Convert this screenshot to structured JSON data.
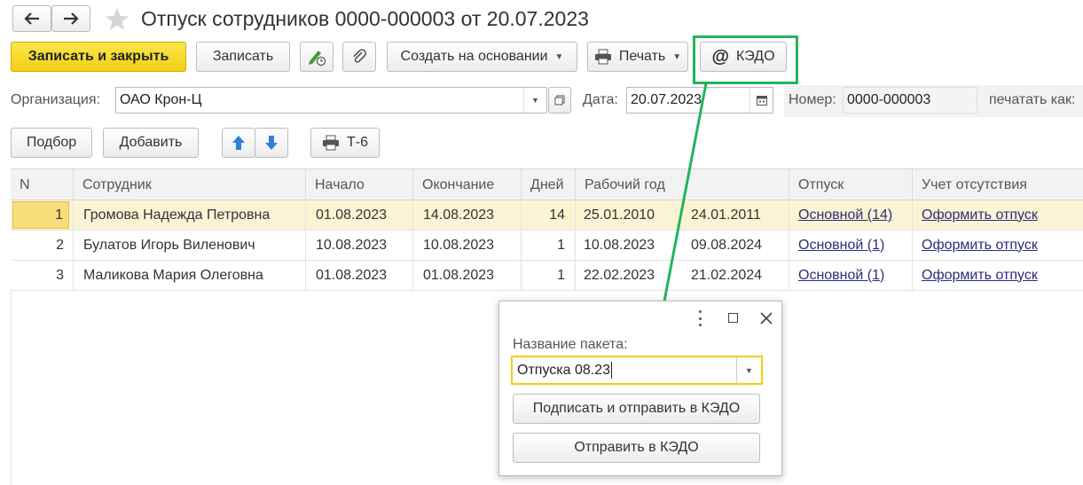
{
  "window": {
    "title": "Отпуск сотрудников 0000-000003 от 20.07.2023"
  },
  "toolbar": {
    "save_close": "Записать и закрыть",
    "save": "Записать",
    "create_based": "Создать на основании",
    "print": "Печать",
    "kedo": "КЭДО"
  },
  "form": {
    "org_label": "Организация:",
    "org_value": "ОАО Крон-Ц",
    "date_label": "Дата:",
    "date_value": "20.07.2023",
    "number_label": "Номер:",
    "number_value": "0000-000003",
    "print_as_label": "печатать как:"
  },
  "table_toolbar": {
    "pick": "Подбор",
    "add": "Добавить",
    "t6": "Т-6"
  },
  "table": {
    "headers": [
      "N",
      "Сотрудник",
      "Начало",
      "Окончание",
      "Дней",
      "Рабочий год",
      "Отпуск",
      "Учет отсутствия"
    ],
    "rows": [
      {
        "n": "1",
        "employee": "Громова Надежда Петровна",
        "start": "01.08.2023",
        "end": "14.08.2023",
        "days": "14",
        "year_from": "25.01.2010",
        "year_to": "24.01.2011",
        "vacation": "Основной (14)",
        "absence": "Оформить отпуск"
      },
      {
        "n": "2",
        "employee": "Булатов Игорь Виленович",
        "start": "10.08.2023",
        "end": "10.08.2023",
        "days": "1",
        "year_from": "10.08.2023",
        "year_to": "09.08.2024",
        "vacation": "Основной (1)",
        "absence": "Оформить отпуск"
      },
      {
        "n": "3",
        "employee": "Маликова Мария Олеговна",
        "start": "01.08.2023",
        "end": "01.08.2023",
        "days": "1",
        "year_from": "22.02.2023",
        "year_to": "21.02.2024",
        "vacation": "Основной (1)",
        "absence": "Оформить отпуск"
      }
    ]
  },
  "dialog": {
    "package_label": "Название пакета:",
    "package_value": "Отпуска 08.23",
    "sign_send": "Подписать и отправить в КЭДО",
    "send": "Отправить в КЭДО"
  },
  "colors": {
    "primary": "#f5d31c",
    "highlight": "#23b45c",
    "selected_row": "#fbf4d4"
  }
}
